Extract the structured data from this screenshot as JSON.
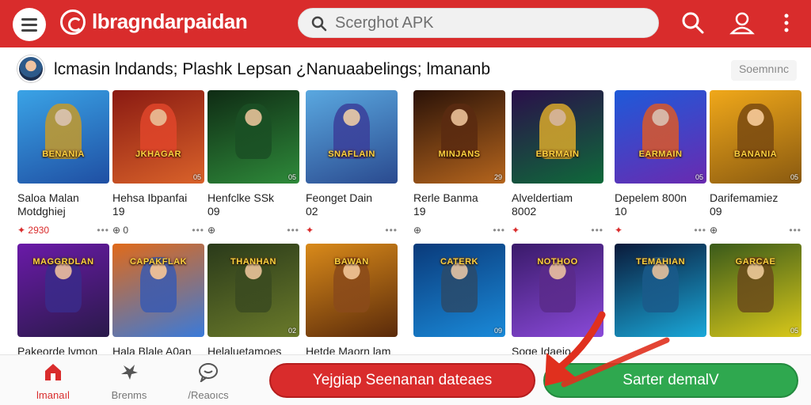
{
  "header": {
    "brand": "lbragndarpaidan",
    "search_placeholder": "Scerghot APK",
    "icons": [
      "menu-icon",
      "brand-logo-icon",
      "search-icon",
      "profile-icon",
      "more-vert-icon"
    ],
    "bar_color": "#d92c2c"
  },
  "section": {
    "title": "lcmasin lndands; Plashk Lepsan ¿Nanuaabelings; lmananb",
    "more": "Soemnınc"
  },
  "apps": [
    {
      "name": "Saloa Malan",
      "sub": "Motdghiej",
      "meta": "✦ 2930",
      "banner": "BENANIA",
      "badge": "",
      "colors": [
        "#3aa3e6",
        "#1f4fa3"
      ],
      "fig": "#c49a2b"
    },
    {
      "name": "Hehsa Ibpanfai",
      "sub": "19",
      "meta": "⊕ 0",
      "banner": "JKHAGAR",
      "badge": "05",
      "colors": [
        "#8a1a12",
        "#d9622a"
      ],
      "fig": "#e0452a"
    },
    {
      "name": "Henfclke SSk",
      "sub": "09",
      "meta": "⊕",
      "banner": "",
      "badge": "05",
      "colors": [
        "#0f2b14",
        "#2e8a3a"
      ],
      "fig": "#1a4f24"
    },
    {
      "name": "Feonget Dain",
      "sub": "02",
      "meta": "✦",
      "banner": "SNAFLAIN",
      "badge": "",
      "colors": [
        "#5aa8e0",
        "#2a4a8f"
      ],
      "fig": "#3a3f9a"
    },
    {
      "name": "Rerle Banma",
      "sub": "19",
      "meta": "⊕",
      "banner": "MINJANS",
      "badge": "29",
      "colors": [
        "#2a1208",
        "#b5651d"
      ],
      "fig": "#5a2a10"
    },
    {
      "name": "Alveldertiam",
      "sub": "8002",
      "meta": "✦",
      "banner": "EBRMAIN",
      "badge": "",
      "colors": [
        "#2a0f4a",
        "#0f6a3a"
      ],
      "fig": "#d9a82a"
    },
    {
      "name": "Depelem 800n",
      "sub": "10",
      "meta": "✦",
      "banner": "EARMAIN",
      "badge": "05",
      "colors": [
        "#1e5ad9",
        "#6a2ab0"
      ],
      "fig": "#d9582a"
    },
    {
      "name": "Darifemamiez",
      "sub": "09",
      "meta": "⊕",
      "banner": "BANANIA",
      "badge": "05",
      "colors": [
        "#f0a81a",
        "#8a5a10"
      ],
      "fig": "#7a4a10"
    },
    {
      "name": "Pakeorde lymon",
      "sub": "",
      "meta": "",
      "banner": "MAGGRDLAN",
      "badge": "",
      "colors": [
        "#6a1aa8",
        "#2a1a4a"
      ],
      "fig": "#3a2a8a"
    },
    {
      "name": "Hala Blale A0an",
      "sub": "",
      "meta": "",
      "banner": "CAPAKFLAK",
      "badge": "",
      "colors": [
        "#e06a1a",
        "#3a7ad9"
      ],
      "fig": "#3a5ab0"
    },
    {
      "name": "Helaluetamoes",
      "sub": "",
      "meta": "",
      "banner": "THANHAN",
      "badge": "02",
      "colors": [
        "#2a3a1a",
        "#6a7a2a"
      ],
      "fig": "#3a4a20"
    },
    {
      "name": "Hetde Maorn lam",
      "sub": "",
      "meta": "",
      "banner": "BAWAN",
      "badge": "",
      "colors": [
        "#d98a1a",
        "#5a2a0a"
      ],
      "fig": "#8a4a1a"
    },
    {
      "name": "",
      "sub": "",
      "meta": "",
      "banner": "CATERK",
      "badge": "09",
      "colors": [
        "#0a3a7a",
        "#1a8ad9"
      ],
      "fig": "#2a4a6a"
    },
    {
      "name": "Soge Idaeio",
      "sub": "",
      "meta": "",
      "banner": "NOTHOO",
      "badge": "",
      "colors": [
        "#3a1a6a",
        "#8a4ad9"
      ],
      "fig": "#5a2a8a"
    },
    {
      "name": "",
      "sub": "",
      "meta": "",
      "banner": "TEMAHIAN",
      "badge": "",
      "colors": [
        "#0a1a3a",
        "#1aa8d9"
      ],
      "fig": "#1a5a8a"
    },
    {
      "name": "",
      "sub": "",
      "meta": "",
      "banner": "GARCAE",
      "badge": "05",
      "colors": [
        "#3a5a1a",
        "#d9c81a"
      ],
      "fig": "#6a4a1a"
    }
  ],
  "bottom_nav": [
    {
      "label": "lmanaıl",
      "icon": "home-icon",
      "active": true
    },
    {
      "label": "Brenms",
      "icon": "bird-icon",
      "active": false
    },
    {
      "label": "/Reaoıcs",
      "icon": "chat-bubble-icon",
      "active": false
    }
  ],
  "cta": {
    "primary": "Yejgiap Seenanan dateaes",
    "secondary": "Sarter demalV",
    "primary_color": "#d92c2c",
    "secondary_color": "#2fa84f"
  }
}
